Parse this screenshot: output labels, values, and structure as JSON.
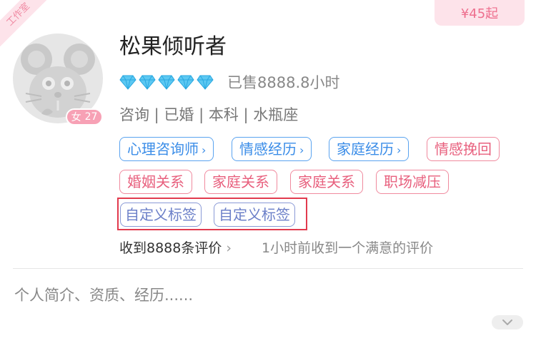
{
  "studio_ribbon": "工作室",
  "price": "¥45起",
  "profile": {
    "name": "松果倾听者",
    "diamond_count": 5,
    "sold": "已售8888.8小时",
    "gender_symbol": "女",
    "age": "27",
    "meta": "咨询 | 已婚 | 本科 | 水瓶座"
  },
  "tags": {
    "blue": [
      "心理咨询师",
      "情感经历",
      "家庭经历"
    ],
    "red_row1": [
      "情感挽回"
    ],
    "red_row2": [
      "婚姻关系",
      "家庭关系",
      "家庭关系",
      "职场减压"
    ],
    "custom": [
      "自定义标签",
      "自定义标签"
    ]
  },
  "reviews": {
    "count_text": "收到8888条评价",
    "recent": "1小时前收到一个满意的评价"
  },
  "intro": "个人简介、资质、经历......",
  "icons": {
    "diamond": "diamond-icon",
    "chevron_right": "chevron-right-icon",
    "chevron_down": "chevron-down-icon",
    "avatar": "mouse-placeholder-icon"
  },
  "colors": {
    "brand_pink": "#ee6f8e",
    "tag_blue": "#3b8de8",
    "tag_red": "#e8607e",
    "highlight_box": "#e23a4e"
  }
}
